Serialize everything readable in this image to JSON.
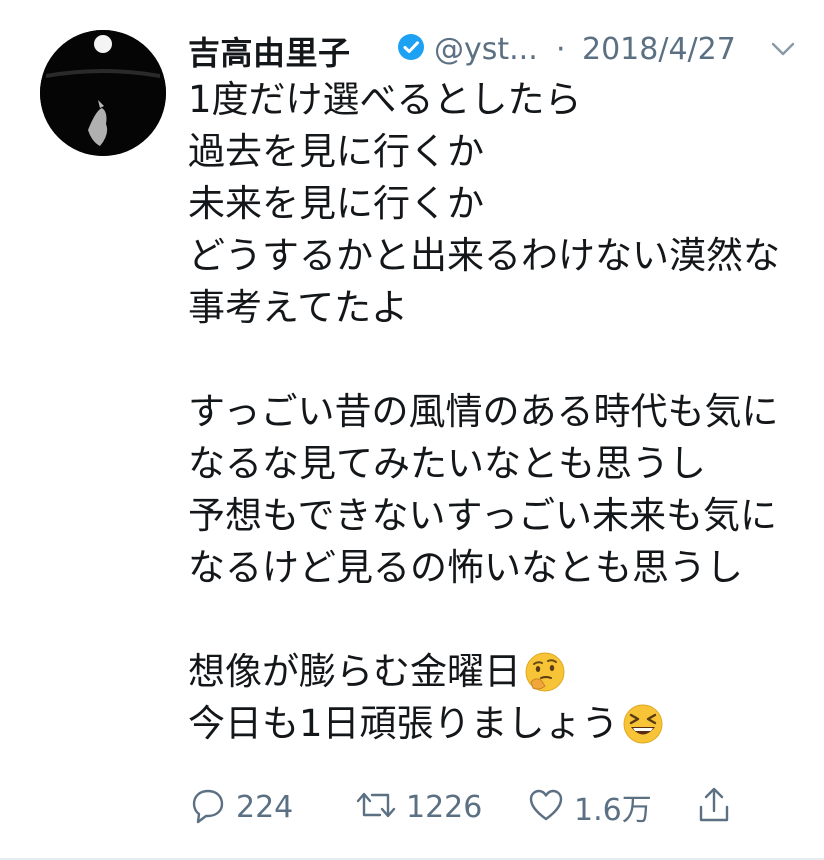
{
  "tweet": {
    "author_name": "吉高由里子",
    "handle": "@yst...",
    "separator": "·",
    "date": "2018/4/27",
    "lines": [
      "1度だけ選べるとしたら",
      "過去を見に行くか",
      "未来を見に行くか",
      "どうするかと出来るわけない漠然な",
      "事考えてたよ",
      "",
      "すっごい昔の風情のある時代も気に",
      "なるな見てみたいなとも思うし",
      "予想もできないすっごい未来も気に",
      "なるけど見るの怖いなとも思うし",
      "",
      "想像が膨らむ金曜日",
      "今日も1日頑張りましょう"
    ],
    "emoji_line_11": "thinking-face-emoji",
    "emoji_line_12": "grinning-squinting-face-emoji"
  },
  "actions": {
    "reply_count": "224",
    "retweet_count": "1226",
    "like_count": "1.6万"
  },
  "colors": {
    "text": "#14171a",
    "muted": "#5b7083",
    "verified": "#1da1f2",
    "emoji": "#f7c437"
  }
}
